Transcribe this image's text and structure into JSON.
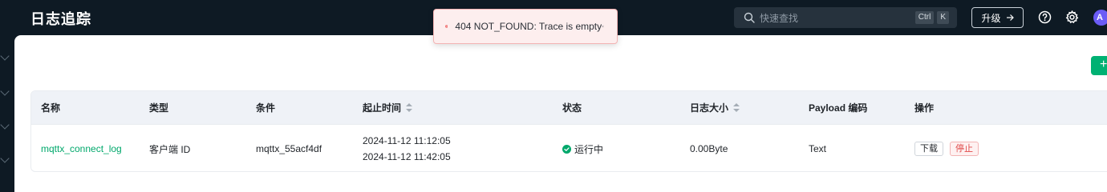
{
  "header": {
    "title": "日志追踪",
    "search_placeholder": "快速查找",
    "shortcut_key1": "Ctrl",
    "shortcut_key2": "K",
    "upgrade_label": "升级",
    "avatar_initial": "A"
  },
  "toast": {
    "message": "404 NOT_FOUND: Trace is empty",
    "type": "error"
  },
  "actions": {
    "add_symbol": "+"
  },
  "table": {
    "headers": {
      "name": "名称",
      "type": "类型",
      "condition": "条件",
      "time_range": "起止时间",
      "status": "状态",
      "log_size": "日志大小",
      "payload_encoding": "Payload 编码",
      "operations": "操作"
    },
    "rows": [
      {
        "name": "mqttx_connect_log",
        "type": "客户端 ID",
        "condition": "mqttx_55acf4df",
        "start_time": "2024-11-12 11:12:05",
        "end_time": "2024-11-12 11:42:05",
        "status": "运行中",
        "log_size": "0.00Byte",
        "payload_encoding": "Text",
        "download_label": "下载",
        "stop_label": "停止"
      }
    ]
  },
  "colors": {
    "header_bg": "#0e1a24",
    "accent": "#00a86b",
    "danger": "#e04b4b",
    "avatar": "#6b5cf6"
  }
}
